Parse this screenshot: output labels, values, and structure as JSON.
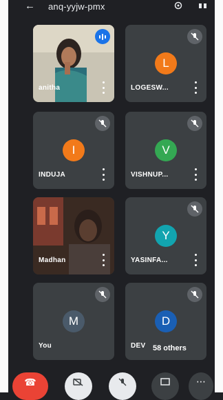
{
  "header": {
    "meeting_code": "anq-yyjw-pmx",
    "back_icon": "arrow-left-icon",
    "camera_switch_icon": "camera-switch-icon",
    "speaker_icon": "speaker-icon"
  },
  "tiles": [
    {
      "name": "anitha",
      "type": "video",
      "status": "speaking"
    },
    {
      "name": "LOGESW...",
      "initial": "L",
      "avatar_color": "#f27a1a",
      "status": "muted"
    },
    {
      "name": "INDUJA",
      "initial": "I",
      "avatar_color": "#f27a1a",
      "status": "muted"
    },
    {
      "name": "VISHNUP...",
      "initial": "V",
      "avatar_color": "#34a853",
      "status": "muted"
    },
    {
      "name": "Madhan",
      "type": "video",
      "status": "none"
    },
    {
      "name": "YASINFA...",
      "initial": "Y",
      "avatar_color": "#12a4af",
      "status": "muted"
    },
    {
      "name": "You",
      "initial": "M",
      "avatar_color": "#4a5a6a",
      "status": "muted"
    },
    {
      "name": "DEV",
      "initial": "D",
      "avatar_color": "#1a5fb4",
      "status": "muted"
    }
  ],
  "others_label": "58 others",
  "controls": [
    {
      "icon": "end-call-icon",
      "color": "#ea4335"
    },
    {
      "icon": "camera-off-icon",
      "color": "#e8eaed"
    },
    {
      "icon": "mic-off-icon",
      "color": "#e8eaed"
    },
    {
      "icon": "present-icon",
      "color": "#3c4043"
    },
    {
      "icon": "more-options-icon",
      "color": "#3c4043"
    }
  ]
}
